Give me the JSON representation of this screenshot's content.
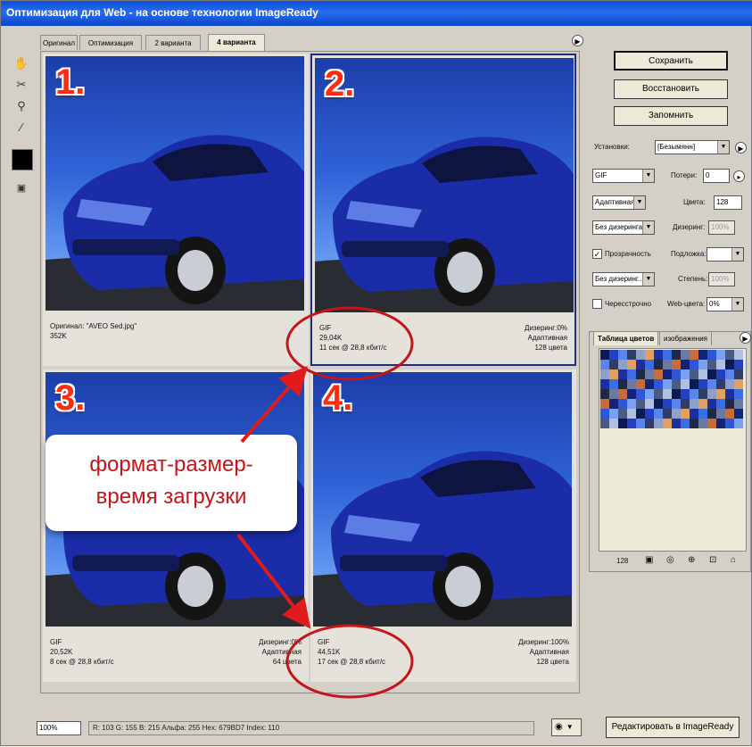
{
  "window": {
    "title": "Оптимизация для Web - на основе технологии ImageReady"
  },
  "tabs": [
    "Оригинал",
    "Оптимизация",
    "2 варианта",
    "4 варианта"
  ],
  "panes": [
    {
      "number": "1.",
      "left": [
        "Оригинал: \"AVEO Sed.jpg\"",
        "352K",
        ""
      ],
      "right": [
        "",
        "",
        ""
      ]
    },
    {
      "number": "2.",
      "left": [
        "GIF",
        "29,04K",
        "11 сек @ 28,8 кбит/с"
      ],
      "right": [
        "Дизеринг:0%",
        "Адаптивная",
        "128 цвета"
      ]
    },
    {
      "number": "3.",
      "left": [
        "GIF",
        "20,52K",
        "8 сек @ 28,8 кбит/с"
      ],
      "right": [
        "Дизеринг:0%",
        "Адаптивная",
        "64 цвета"
      ]
    },
    {
      "number": "4.",
      "left": [
        "GIF",
        "44,51K",
        "17 сек @ 28,8 кбит/с"
      ],
      "right": [
        "Дизеринг:100%",
        "Адаптивная",
        "128 цвета"
      ]
    }
  ],
  "actions": {
    "save": "Сохранить",
    "reset": "Восстановить",
    "remember": "Запомнить"
  },
  "settings": {
    "preset_label": "Установки:",
    "preset_value": "[Безымянн]",
    "format": "GIF",
    "loss_label": "Потери:",
    "loss_value": "0",
    "reduction": "Адаптивная",
    "colors_label": "Цвета:",
    "colors_value": "128",
    "dither_algo": "Без дизеринга",
    "dither_label": "Дизеринг:",
    "dither_value": "100%",
    "transparency_label": "Прозрачность",
    "matte_label": "Подложка:",
    "transp_dither": "Без дизеринг...",
    "amount_label": "Степень:",
    "amount_value": "100%",
    "interlaced_label": "Чересстрочно",
    "websnap_label": "Web-цвета:",
    "websnap_value": "0%"
  },
  "color_table": {
    "tab_active": "Таблица цветов",
    "tab_inactive": "изображения",
    "count": "128"
  },
  "status": {
    "zoom": "100%",
    "readout": "R:  103   G:   155   B:   215   Альфа: 255   Hex:     679BD7   Index:          110"
  },
  "footer": {
    "edit_button": "Редактировать в ImageReady"
  },
  "callout": {
    "line1": "формат-размер-",
    "line2": "время загрузки"
  },
  "colors": {
    "title_bar": "#0a4fd8",
    "highlight_red": "#c4151b"
  }
}
